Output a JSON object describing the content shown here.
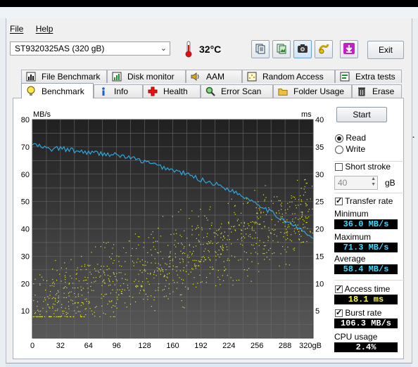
{
  "menu": {
    "file": "File",
    "help": "Help"
  },
  "drive": {
    "selected": "ST9320325AS (320 gB)"
  },
  "temperature": "32°C",
  "toolbar": {
    "icons": [
      "copy-text-icon",
      "copy-image-icon",
      "screenshot-camera-icon",
      "health-settings-icon",
      "save-download-icon"
    ],
    "exit_label": "Exit"
  },
  "tabs_row1": [
    {
      "label": "File Benchmark",
      "icon": "file-benchmark-icon"
    },
    {
      "label": "Disk monitor",
      "icon": "disk-monitor-icon"
    },
    {
      "label": "AAM",
      "icon": "speaker-icon"
    },
    {
      "label": "Random Access",
      "icon": "random-access-icon"
    },
    {
      "label": "Extra tests",
      "icon": "extra-tests-icon"
    }
  ],
  "tabs_row2": [
    {
      "label": "Benchmark",
      "icon": "bulb-icon",
      "active": true
    },
    {
      "label": "Info",
      "icon": "info-icon"
    },
    {
      "label": "Health",
      "icon": "health-cross-icon"
    },
    {
      "label": "Error Scan",
      "icon": "magnifier-icon"
    },
    {
      "label": "Folder Usage",
      "icon": "folder-icon"
    },
    {
      "label": "Erase",
      "icon": "trash-icon"
    }
  ],
  "benchmark": {
    "start_label": "Start",
    "mode_options": [
      "Read",
      "Write"
    ],
    "mode_selected": "Read",
    "short_stroke_label": "Short stroke",
    "short_stroke_checked": false,
    "short_stroke_value": "40",
    "short_stroke_unit": "gB",
    "transfer_rate_label": "Transfer rate",
    "transfer_rate_checked": true,
    "minimum_label": "Minimum",
    "minimum_value": "36.0 MB/s",
    "maximum_label": "Maximum",
    "maximum_value": "71.3 MB/s",
    "average_label": "Average",
    "average_value": "58.4 MB/s",
    "access_time_label": "Access time",
    "access_time_checked": true,
    "access_time_value": "18.1 ms",
    "burst_rate_label": "Burst rate",
    "burst_rate_checked": true,
    "burst_rate_value": "106.3 MB/s",
    "cpu_usage_label": "CPU usage",
    "cpu_usage_value": "2.4%"
  },
  "colors": {
    "transfer_line": "#2ea6e0",
    "access_points": "#e6e62a",
    "min_max_value": "#3fd8ff",
    "access_value": "#ffff33"
  },
  "chart_data": {
    "type": "line",
    "left_axis_unit": "MB/s",
    "right_axis_unit": "ms",
    "x_ticks": [
      "0",
      "32",
      "64",
      "96",
      "128",
      "160",
      "192",
      "224",
      "256",
      "288",
      "320gB"
    ],
    "y_left_ticks": [
      "10",
      "20",
      "30",
      "40",
      "50",
      "60",
      "70",
      "80"
    ],
    "y_right_ticks": [
      "5",
      "10",
      "15",
      "20",
      "25",
      "30",
      "35",
      "40"
    ],
    "xlim": [
      0,
      320
    ],
    "ylim_left": [
      0,
      80
    ],
    "ylim_right": [
      0,
      40
    ],
    "grid": true,
    "series": [
      {
        "name": "Transfer rate",
        "axis": "left",
        "x": [
          0,
          10,
          20,
          32,
          48,
          64,
          80,
          96,
          112,
          128,
          144,
          160,
          176,
          192,
          208,
          224,
          240,
          256,
          272,
          288,
          304,
          312,
          320
        ],
        "y": [
          71,
          70,
          69,
          69.5,
          68.5,
          68,
          67.5,
          67,
          66,
          64.5,
          63,
          61.5,
          60,
          58,
          56.5,
          54.5,
          52,
          49.5,
          46,
          43,
          40,
          38.5,
          36
        ]
      },
      {
        "name": "Access time",
        "axis": "right",
        "type": "scatter",
        "x_range": [
          0,
          320
        ],
        "y_range_ms": [
          4,
          33
        ],
        "points": 1000
      }
    ]
  }
}
